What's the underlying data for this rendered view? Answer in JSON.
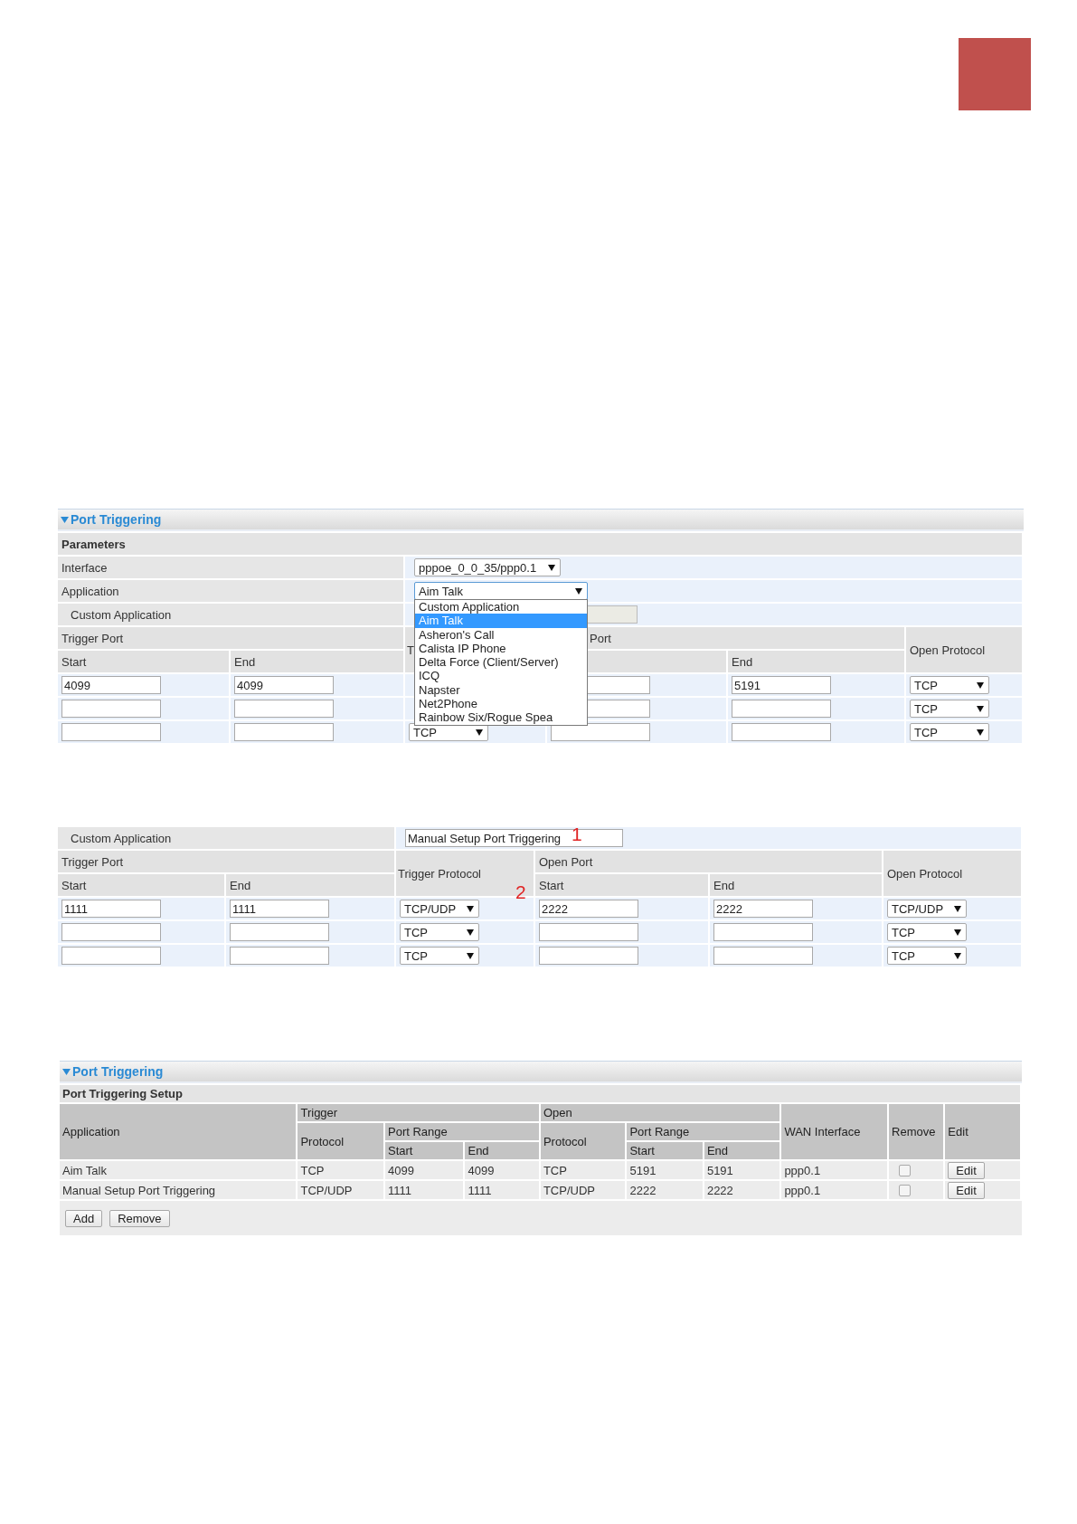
{
  "panel_1": {
    "title": "Port Triggering",
    "section": "Parameters",
    "fields": [
      {
        "kind": "select",
        "label": "Interface",
        "value": "pppoe_0_0_35/ppp0.1",
        "expanded": false
      },
      {
        "kind": "select",
        "label": "Application",
        "value": "Aim Talk",
        "expanded": true,
        "options": [
          {
            "label": "Custom Application",
            "selected": false
          },
          {
            "label": "Aim Talk",
            "selected": true
          },
          {
            "label": "Asheron's Call",
            "selected": false
          },
          {
            "label": "Calista IP Phone",
            "selected": false
          },
          {
            "label": "Delta Force (Client/Server)",
            "selected": false
          },
          {
            "label": "ICQ",
            "selected": false
          },
          {
            "label": "Napster",
            "selected": false
          },
          {
            "label": "Net2Phone",
            "selected": false
          },
          {
            "label": "Rainbow Six/Rogue Spea",
            "selected": false
          }
        ]
      },
      {
        "kind": "text",
        "label": "Custom Application",
        "disabled": true
      }
    ],
    "headers": {
      "trigger_port": "Trigger Port",
      "trigger_start": "Start",
      "trigger_end": "End",
      "trigger_protocol": "T",
      "open_port": "Port",
      "open_end": "End",
      "open_protocol": "Open Protocol"
    },
    "rows": [
      {
        "trigger_start": "4099",
        "trigger_end": "4099",
        "open_end": "5191",
        "open_protocol": "TCP"
      },
      {
        "open_protocol": "TCP"
      },
      {
        "trigger_protocol": "TCP",
        "open_protocol": "TCP"
      }
    ]
  },
  "panel_2": {
    "fields": [
      {
        "kind": "text",
        "label": "Custom Application",
        "value": "Manual Setup Port Triggering",
        "disabled": false
      }
    ],
    "headers": {
      "trigger_port": "Trigger Port",
      "trigger_start": "Start",
      "trigger_end": "End",
      "trigger_protocol": "Trigger Protocol",
      "open_port": "Open Port",
      "open_start": "Start",
      "open_end": "End",
      "open_protocol": "Open Protocol"
    },
    "rows": [
      {
        "trigger_start": "1111",
        "trigger_end": "1111",
        "trigger_protocol": "TCP/UDP",
        "open_start": "2222",
        "open_end": "2222",
        "open_protocol": "TCP/UDP"
      },
      {
        "trigger_protocol": "TCP",
        "open_protocol": "TCP"
      },
      {
        "trigger_protocol": "TCP",
        "open_protocol": "TCP"
      }
    ],
    "annotations": [
      "1",
      "2"
    ]
  },
  "panel_3": {
    "title": "Port Triggering",
    "section": "Port Triggering Setup",
    "headers": {
      "application": "Application",
      "trigger": "Trigger",
      "open": "Open",
      "wan_interface": "WAN Interface",
      "remove": "Remove",
      "edit": "Edit",
      "trigger_protocol": "Protocol",
      "trigger_port_range": "Port Range",
      "open_protocol": "Protocol",
      "open_port_range": "Port Range",
      "trigger_start": "Start",
      "trigger_end": "End",
      "open_start": "Start",
      "open_end": "End"
    },
    "rows": [
      {
        "application": "Aim Talk",
        "trigger_protocol": "TCP",
        "trigger_start": "4099",
        "trigger_end": "4099",
        "open_protocol": "TCP",
        "open_start": "5191",
        "open_end": "5191",
        "wan_interface": "ppp0.1",
        "remove": false,
        "edit": "Edit"
      },
      {
        "application": "Manual Setup Port Triggering",
        "trigger_protocol": "TCP/UDP",
        "trigger_start": "1111",
        "trigger_end": "1111",
        "open_protocol": "TCP/UDP",
        "open_start": "2222",
        "open_end": "2222",
        "wan_interface": "ppp0.1",
        "remove": false,
        "edit": "Edit"
      }
    ],
    "buttons": [
      "Add",
      "Remove"
    ]
  }
}
